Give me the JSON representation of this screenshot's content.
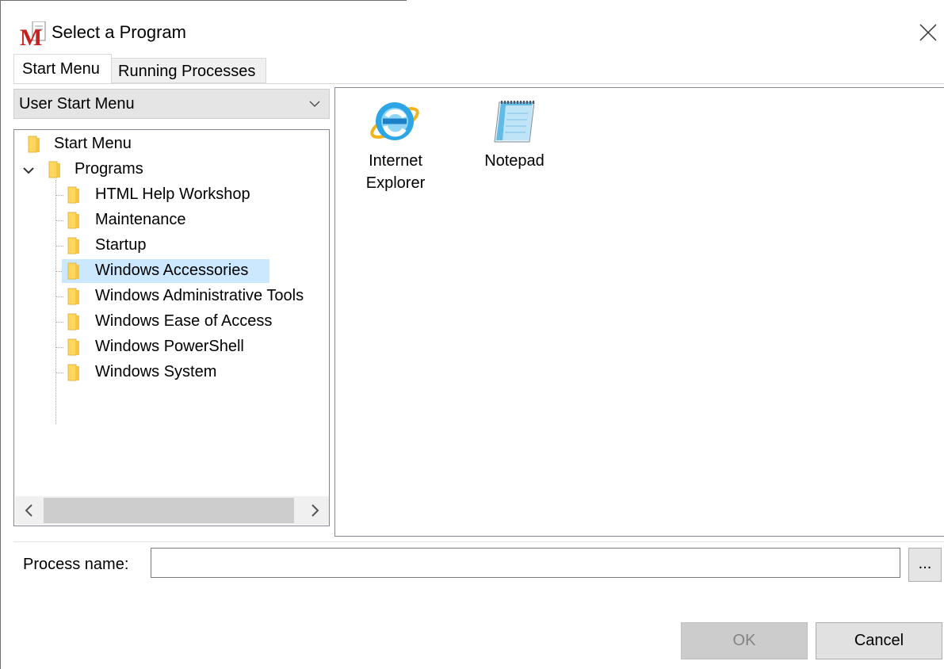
{
  "window": {
    "title": "Select a Program",
    "close_icon": "close-icon"
  },
  "tabs": [
    {
      "label": "Start Menu",
      "active": true
    },
    {
      "label": "Running Processes",
      "active": false
    }
  ],
  "menu_select": {
    "value": "User Start Menu"
  },
  "tree": {
    "root": "Start Menu",
    "programs": "Programs",
    "children": [
      "HTML Help Workshop",
      "Maintenance",
      "Startup",
      "Windows Accessories",
      "Windows Administrative Tools",
      "Windows Ease of Access",
      "Windows PowerShell",
      "Windows System"
    ],
    "selected": "Windows Accessories"
  },
  "programs": [
    {
      "label_line1": "Internet",
      "label_line2": "Explorer",
      "icon": "internet-explorer-icon"
    },
    {
      "label_line1": "Notepad",
      "label_line2": "",
      "icon": "notepad-icon"
    }
  ],
  "process_name": {
    "label": "Process name:",
    "value": "",
    "browse_label": "..."
  },
  "buttons": {
    "ok": "OK",
    "cancel": "Cancel"
  },
  "colors": {
    "selection": "#cce8ff",
    "folder": "#ffd75e"
  }
}
